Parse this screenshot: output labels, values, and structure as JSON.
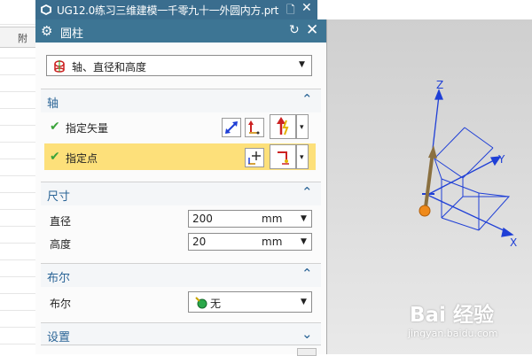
{
  "left_panel": {
    "header_fragment": "附"
  },
  "tab": {
    "title": "UG12.0练习三维建模一千零九十一外圆内方.prt",
    "pin_glyph": "🗋",
    "close_glyph": "✕"
  },
  "dialog": {
    "title": "圆柱",
    "reset_glyph": "↻",
    "close_glyph": "✕",
    "type_value": "轴、直径和高度",
    "axis": {
      "title": "轴",
      "specify_vector": "指定矢量",
      "specify_point": "指定点",
      "vector_btn_1_glyph": "⤢",
      "vector_btn_2_glyph": "↰",
      "point_btn_glyph": "+"
    },
    "dimensions": {
      "title": "尺寸",
      "diameter_label": "直径",
      "diameter_value": "200",
      "diameter_unit": "mm",
      "height_label": "高度",
      "height_value": "20",
      "height_unit": "mm"
    },
    "boolean": {
      "title": "布尔",
      "label": "布尔",
      "value": "无"
    },
    "settings": {
      "title": "设置"
    }
  },
  "viewport": {
    "axis_x": "X",
    "axis_y": "Y",
    "axis_z": "Z"
  },
  "watermark": {
    "brand": "Bai 经验",
    "url": "jingyan.baidu.com"
  },
  "colors": {
    "tab_bg": "#3a6d8e",
    "title_bg": "#3d7594",
    "section_text": "#2a6496",
    "highlight": "#fde07a",
    "wcs": "#1f3fd6"
  }
}
